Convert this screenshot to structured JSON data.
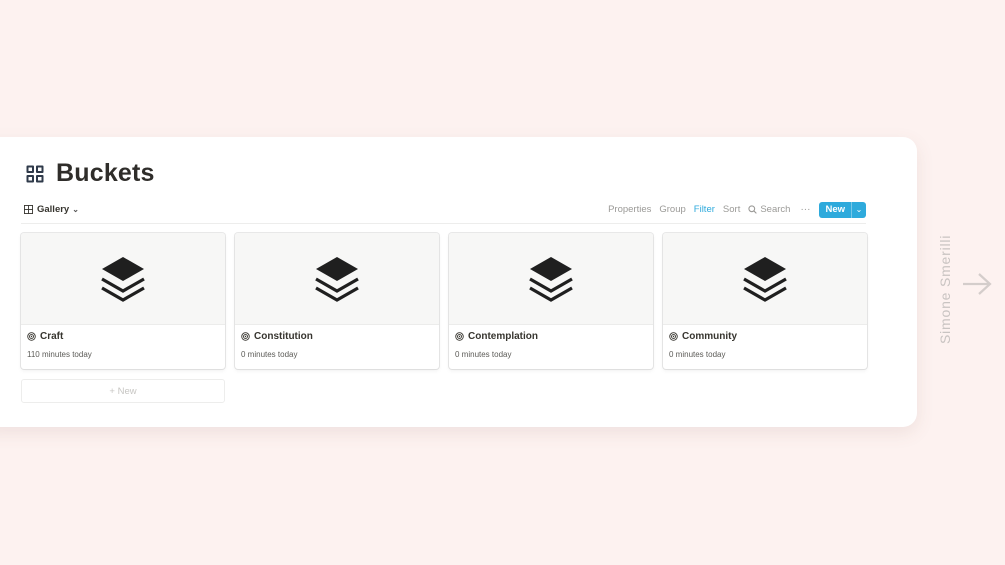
{
  "page": {
    "title": "Buckets",
    "title_icon": "gallery-grid-icon"
  },
  "toolbar": {
    "view_label": "Gallery",
    "view_icon": "gallery-view-icon",
    "properties_label": "Properties",
    "group_label": "Group",
    "filter_label": "Filter",
    "sort_label": "Sort",
    "search_label": "Search",
    "more_label": "···",
    "new_label": "New",
    "new_dropdown_label": "⌄"
  },
  "cards": [
    {
      "title": "Craft",
      "subtitle": "110 minutes today",
      "icon": "target-icon",
      "cover_icon": "stack-layers-icon"
    },
    {
      "title": "Constitution",
      "subtitle": "0 minutes today",
      "icon": "target-icon",
      "cover_icon": "stack-layers-icon"
    },
    {
      "title": "Contemplation",
      "subtitle": "0 minutes today",
      "icon": "target-icon",
      "cover_icon": "stack-layers-icon"
    },
    {
      "title": "Community",
      "subtitle": "0 minutes today",
      "icon": "target-icon",
      "cover_icon": "stack-layers-icon"
    }
  ],
  "add_new_label": "+ New",
  "side": {
    "author": "Simone Smerilli",
    "next_icon": "arrow-right-icon"
  },
  "colors": {
    "background": "#fdf2f0",
    "accent": "#2eaadc",
    "title": "#2f2d2a"
  }
}
